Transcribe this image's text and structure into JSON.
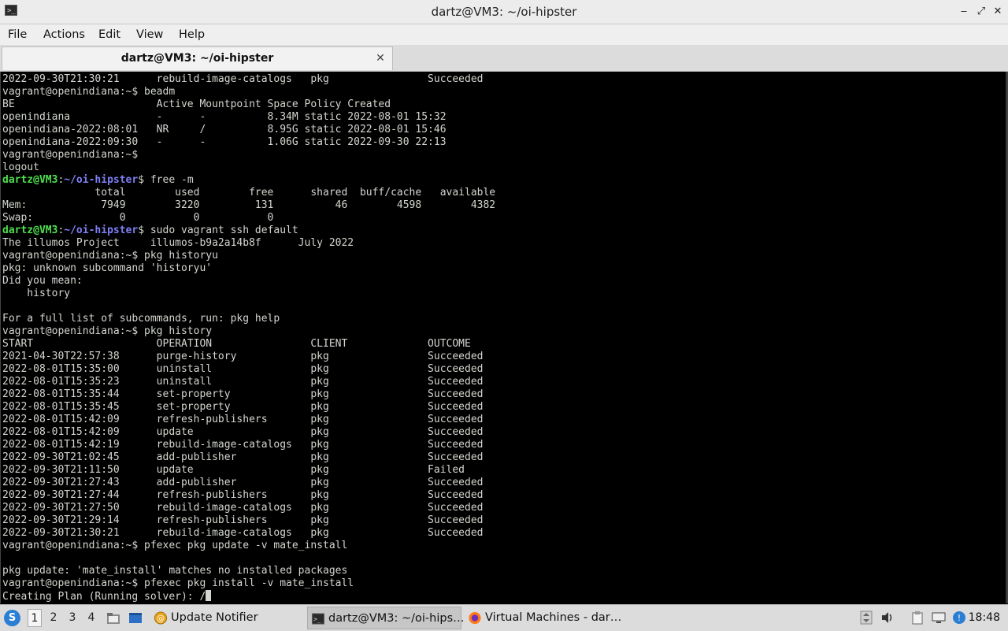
{
  "window": {
    "title": "dartz@VM3: ~/oi-hipster",
    "minimize_glyph": "‒",
    "maximize_glyph": "⤢",
    "close_glyph": "✕"
  },
  "menu": [
    "File",
    "Actions",
    "Edit",
    "View",
    "Help"
  ],
  "tab": {
    "label": "dartz@VM3: ~/oi-hipster",
    "close_glyph": "✕"
  },
  "terminal": {
    "lines": [
      "2022-09-30T21:30:21      rebuild-image-catalogs   pkg                Succeeded",
      "vagrant@openindiana:~$ beadm",
      "BE                       Active Mountpoint Space Policy Created",
      "openindiana              -      -          8.34M static 2022-08-01 15:32",
      "openindiana-2022:08:01   NR     /          8.95G static 2022-08-01 15:46",
      "openindiana-2022:09:30   -      -          1.06G static 2022-09-30 22:13",
      "vagrant@openindiana:~$",
      "logout",
      {
        "prompt_user": "dartz@VM3",
        "prompt_path": "~/oi-hipster",
        "cmd": "$ free -m"
      },
      "               total        used        free      shared  buff/cache   available",
      "Mem:            7949        3220         131          46        4598        4382",
      "Swap:              0           0           0",
      {
        "prompt_user": "dartz@VM3",
        "prompt_path": "~/oi-hipster",
        "cmd": "$ sudo vagrant ssh default"
      },
      "The illumos Project     illumos-b9a2a14b8f      July 2022",
      "vagrant@openindiana:~$ pkg historyu",
      "pkg: unknown subcommand 'historyu'",
      "Did you mean:",
      "    history",
      "",
      "For a full list of subcommands, run: pkg help",
      "vagrant@openindiana:~$ pkg history",
      "START                    OPERATION                CLIENT             OUTCOME",
      "2021-04-30T22:57:38      purge-history            pkg                Succeeded",
      "2022-08-01T15:35:00      uninstall                pkg                Succeeded",
      "2022-08-01T15:35:23      uninstall                pkg                Succeeded",
      "2022-08-01T15:35:44      set-property             pkg                Succeeded",
      "2022-08-01T15:35:45      set-property             pkg                Succeeded",
      "2022-08-01T15:42:09      refresh-publishers       pkg                Succeeded",
      "2022-08-01T15:42:09      update                   pkg                Succeeded",
      "2022-08-01T15:42:19      rebuild-image-catalogs   pkg                Succeeded",
      "2022-09-30T21:02:45      add-publisher            pkg                Succeeded",
      "2022-09-30T21:11:50      update                   pkg                Failed",
      "2022-09-30T21:27:43      add-publisher            pkg                Succeeded",
      "2022-09-30T21:27:44      refresh-publishers       pkg                Succeeded",
      "2022-09-30T21:27:50      rebuild-image-catalogs   pkg                Succeeded",
      "2022-09-30T21:29:14      refresh-publishers       pkg                Succeeded",
      "2022-09-30T21:30:21      rebuild-image-catalogs   pkg                Succeeded",
      "vagrant@openindiana:~$ pfexec pkg update -v mate_install",
      "",
      "pkg update: 'mate_install' matches no installed packages",
      "vagrant@openindiana:~$ pfexec pkg install -v mate_install",
      {
        "text": "Creating Plan (Running solver): /",
        "cursor": true
      }
    ]
  },
  "taskbar": {
    "workspaces": [
      "1",
      "2",
      "3",
      "4"
    ],
    "active_workspace": "1",
    "tasks": [
      {
        "label": "Update Notifier",
        "icon": "update-notifier-icon"
      },
      {
        "label": "dartz@VM3: ~/oi-hips…",
        "icon": "terminal-icon",
        "active": true
      },
      {
        "label": "Virtual Machines - dar…",
        "icon": "firefox-icon"
      }
    ],
    "clock": "18:48"
  },
  "colors": {
    "prompt_user": "#4ee04e",
    "prompt_path": "#7f7ff5",
    "terminal_fg": "#d3d7cf",
    "terminal_bg": "#000000"
  }
}
